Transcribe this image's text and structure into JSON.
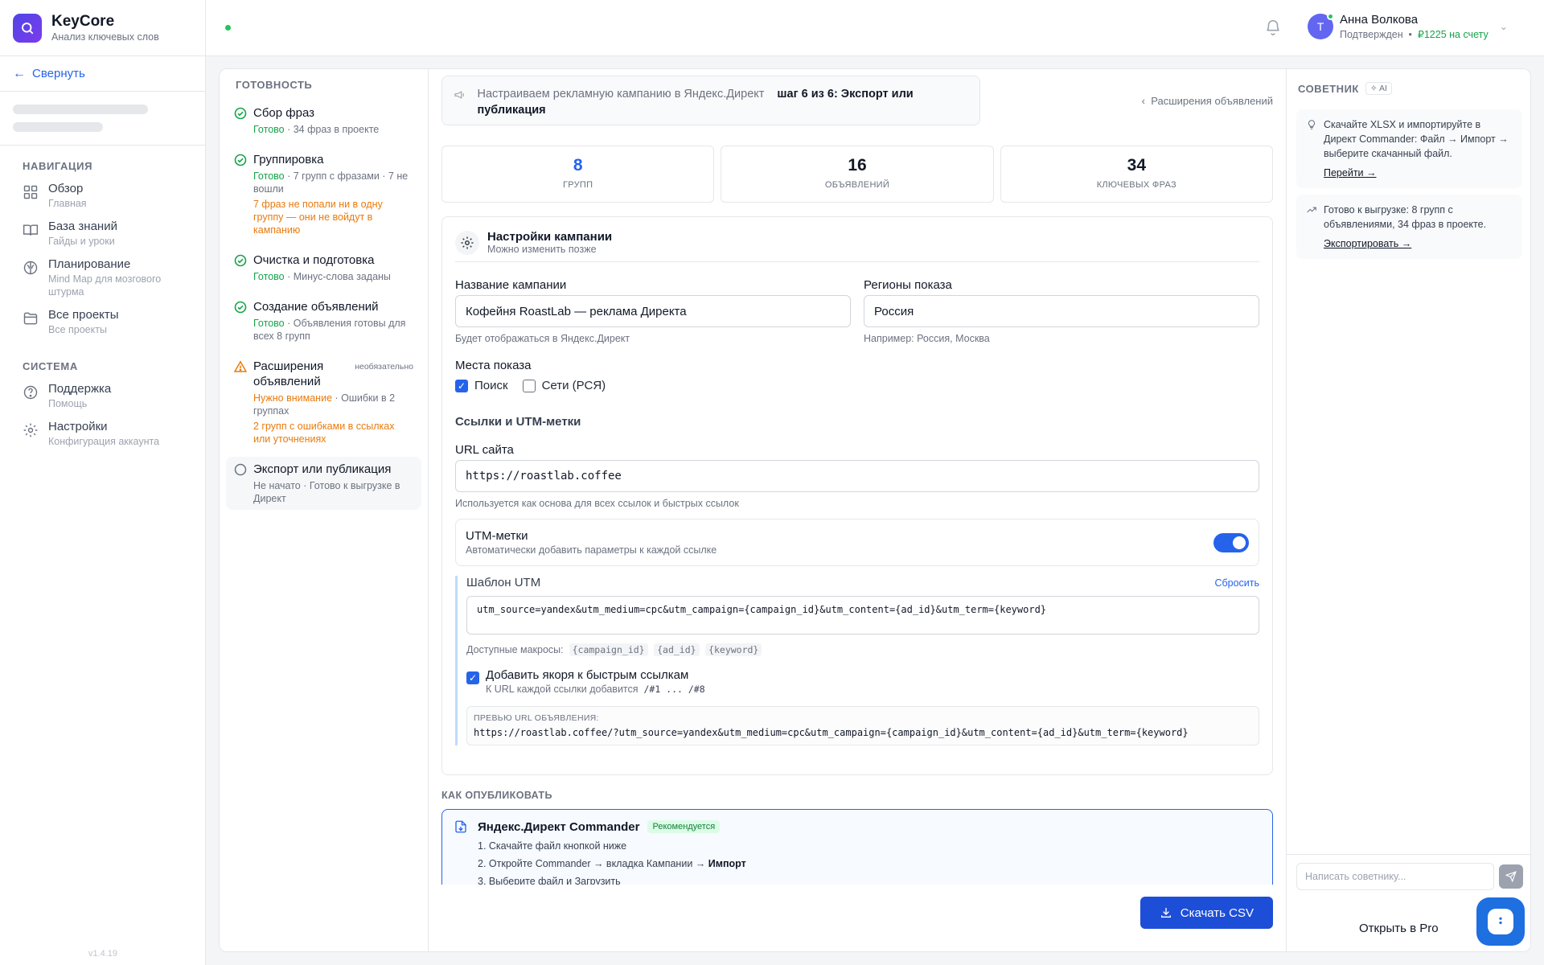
{
  "brand": {
    "name": "KeyCore",
    "subtitle": "Анализ ключевых слов"
  },
  "sidebar": {
    "collapse_label": "Свернуть",
    "nav_title": "НАВИГАЦИЯ",
    "nav_items": [
      {
        "label": "Обзор",
        "sub": "Главная",
        "icon": "grid-icon"
      },
      {
        "label": "База знаний",
        "sub": "Гайды и уроки",
        "icon": "book-icon"
      },
      {
        "label": "Планирование",
        "sub": "Mind Map для мозгового штурма",
        "icon": "brain-icon"
      },
      {
        "label": "Все проекты",
        "sub": "Все проекты",
        "icon": "folder-icon"
      }
    ],
    "system_title": "СИСТЕМА",
    "system_items": [
      {
        "label": "Поддержка",
        "sub": "Помощь",
        "icon": "help-icon"
      },
      {
        "label": "Настройки",
        "sub": "Конфигурация аккаунта",
        "icon": "gear-icon"
      }
    ],
    "version": "v1.4.19"
  },
  "header": {
    "user_initial": "Т",
    "user_name": "Анна Волкова",
    "user_status": "Подтвержден",
    "balance": "₽1225 на счету"
  },
  "readiness": {
    "title": "ГОТОВНОСТЬ",
    "optional_label": "необязательно",
    "steps": [
      {
        "title": "Сбор фраз",
        "status": "Готово",
        "meta": " · 34 фраз в проекте",
        "warn": ""
      },
      {
        "title": "Группировка",
        "status": "Готово",
        "meta": " · 7 групп с фразами · 7 не вошли",
        "warn": "7 фраз не попали ни в одну группу — они не войдут в кампанию"
      },
      {
        "title": "Очистка и подготовка",
        "status": "Готово",
        "meta": " · Минус-слова заданы",
        "warn": ""
      },
      {
        "title": "Создание объявлений",
        "status": "Готово",
        "meta": " · Объявления готовы для всех 8 групп",
        "warn": ""
      },
      {
        "title": "Расширения объявлений",
        "status": "Нужно внимание",
        "meta": " · Ошибки в 2 группах",
        "warn": "2 групп с ошибками в ссылках или уточнениях"
      },
      {
        "title": "Экспорт или публикация",
        "status": "Не начато",
        "meta": " · Готово к выгрузке в Директ",
        "warn": ""
      }
    ]
  },
  "banner": {
    "text": "Настраиваем рекламную кампанию в Яндекс.Директ",
    "step": "шаг 6 из 6: Экспорт или публикация",
    "back": "Расширения объявлений"
  },
  "stats": [
    {
      "value": "8",
      "label": "ГРУПП"
    },
    {
      "value": "16",
      "label": "ОБЪЯВЛЕНИЙ"
    },
    {
      "value": "34",
      "label": "КЛЮЧЕВЫХ ФРАЗ"
    }
  ],
  "settings": {
    "title": "Настройки кампании",
    "subtitle": "Можно изменить позже",
    "campaign_label": "Название кампании",
    "campaign_value": "Кофейня RoastLab — реклама Директа",
    "campaign_hint": "Будет отображаться в Яндекс.Директ",
    "regions_label": "Регионы показа",
    "regions_value": "Россия",
    "regions_hint": "Например: Россия, Москва",
    "places_label": "Места показа",
    "place_search": "Поиск",
    "place_networks": "Сети (РСЯ)",
    "links_title": "Ссылки и UTM-метки",
    "url_label": "URL сайта",
    "url_value": "https://roastlab.coffee",
    "url_hint": "Используется как основа для всех ссылок и быстрых ссылок",
    "utm_title": "UTM-метки",
    "utm_sub": "Автоматически добавить параметры к каждой ссылке",
    "tmpl_label": "Шаблон UTM",
    "reset_label": "Сбросить",
    "tmpl_value": "utm_source=yandex&utm_medium=cpc&utm_campaign={campaign_id}&utm_content={ad_id}&utm_term={keyword}",
    "macros_label": "Доступные макросы:",
    "macros": [
      "{campaign_id}",
      "{ad_id}",
      "{keyword}"
    ],
    "anchors_label": "Добавить якоря к быстрым ссылкам",
    "anchors_hint": "К URL каждой ссылки добавится",
    "anchors_code": "/#1 ... /#8",
    "preview_label": "ПРЕВЬЮ URL ОБЪЯВЛЕНИЯ:",
    "preview_value": "https://roastlab.coffee/?utm_source=yandex&utm_medium=cpc&utm_campaign={campaign_id}&utm_content={ad_id}&utm_term={keyword}"
  },
  "publish": {
    "title": "КАК ОПУБЛИКОВАТЬ",
    "card_name": "Яндекс.Директ Commander",
    "badge": "Рекомендуется",
    "step1": "1. Скачайте файл кнопкой ниже",
    "step2_prefix": "2. Откройте Commander → вкладка Кампании → ",
    "step2_bold": "Импорт",
    "step3": "3. Выберите файл и Загрузить"
  },
  "download_label": "Скачать CSV",
  "advisor": {
    "title": "СОВЕТНИК",
    "ai_badge": "AI",
    "tip1": "Скачайте XLSX и импортируйте в Директ Commander: Файл → Импорт → выберите скачанный файл.",
    "tip1_link": "Перейти →",
    "tip2": "Готово к выгрузке: 8 групп с объявлениями, 34 фраз в проекте.",
    "tip2_link": "Экспортировать →",
    "input_placeholder": "Написать советнику...",
    "pro_label": "Открыть в Pro"
  },
  "colors": {
    "accent": "#2563eb",
    "success": "#16a34a",
    "warning": "#ea7a0c",
    "brand": "#4f46e5"
  }
}
